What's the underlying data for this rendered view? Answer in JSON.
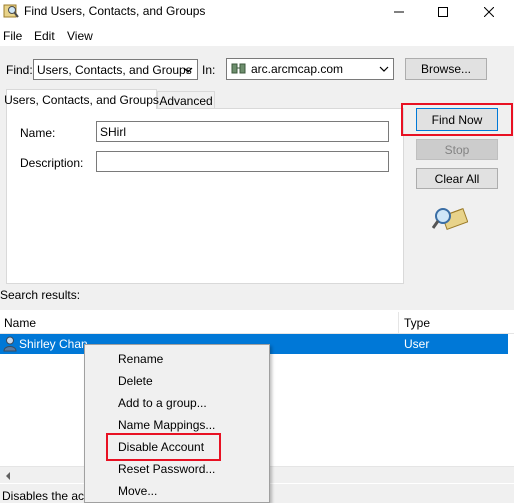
{
  "window": {
    "title": "Find Users, Contacts, and Groups",
    "icon": "find-users-icon"
  },
  "menu": [
    "File",
    "Edit",
    "View"
  ],
  "find_row": {
    "find_label": "Find:",
    "find_value": "Users, Contacts, and Groups",
    "in_label": "In:",
    "in_value": "arc.arcmcap.com",
    "browse_label": "Browse..."
  },
  "tabs": [
    "Users, Contacts, and Groups",
    "Advanced"
  ],
  "form": {
    "name_label": "Name:",
    "name_value": "SHirl",
    "description_label": "Description:",
    "description_value": ""
  },
  "buttons": {
    "find_now": "Find Now",
    "stop": "Stop",
    "clear_all": "Clear All"
  },
  "results": {
    "label": "Search results:",
    "columns": [
      "Name",
      "Type"
    ],
    "rows": [
      {
        "name": "Shirley Chan",
        "type": "User"
      }
    ]
  },
  "context_menu": [
    "Rename",
    "Delete",
    "Add to a group...",
    "Name Mappings...",
    "Disable Account",
    "Reset Password...",
    "Move..."
  ],
  "status": "Disables the acc",
  "colors": {
    "selection": "#0078d7",
    "highlight_box": "#e81123"
  }
}
